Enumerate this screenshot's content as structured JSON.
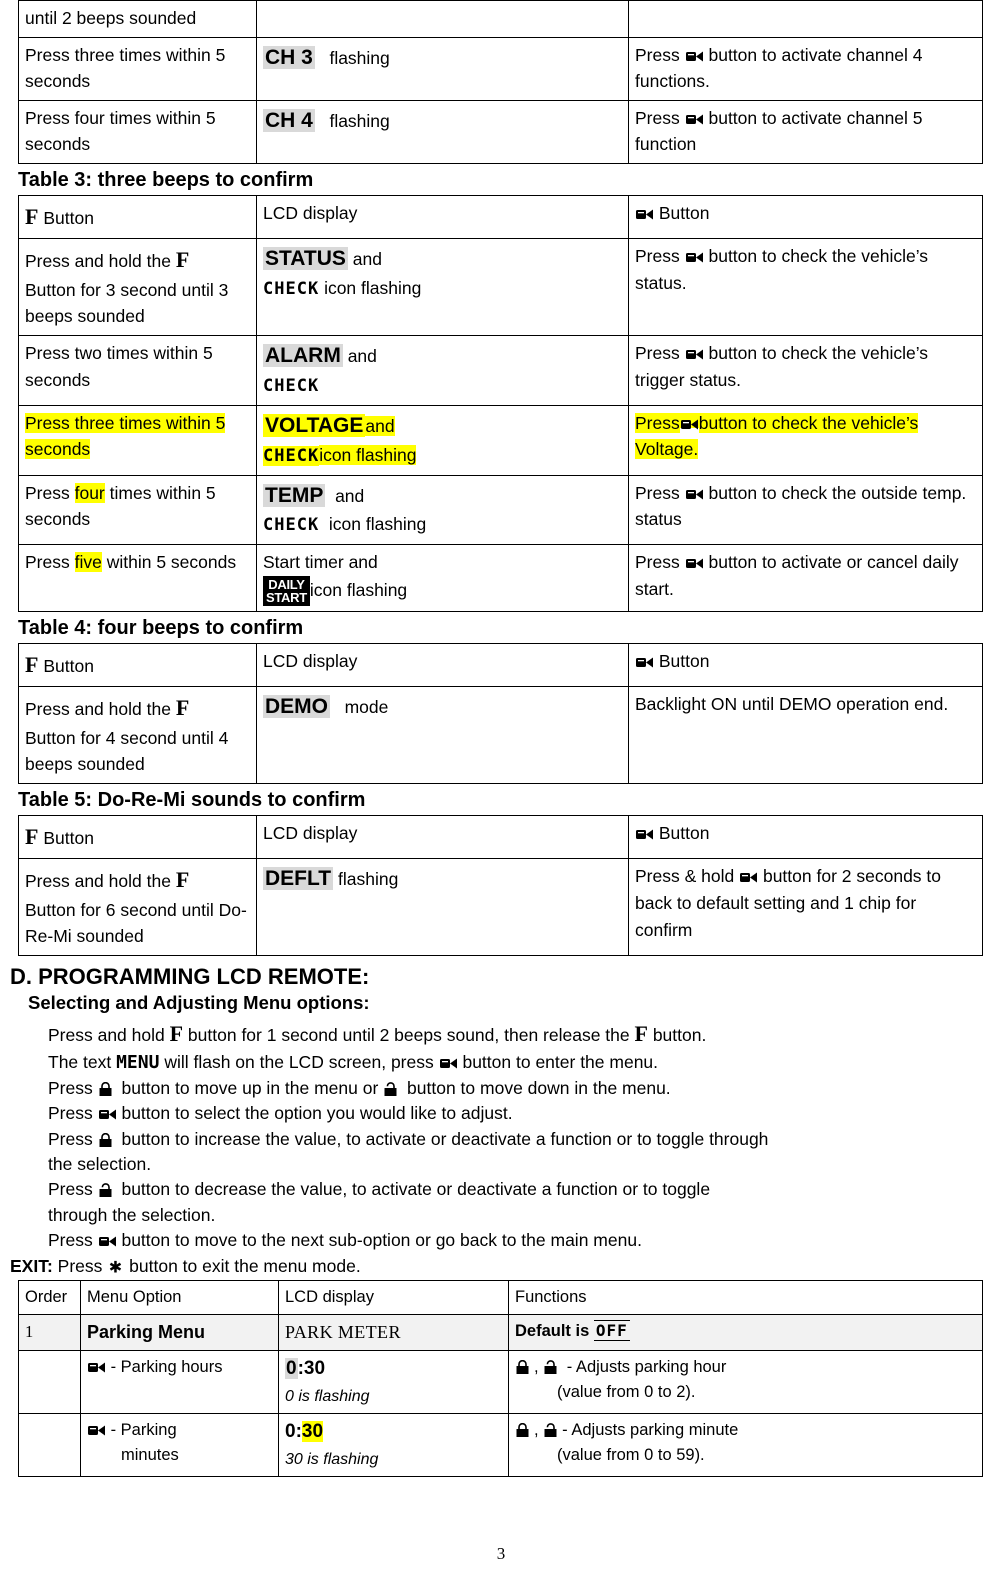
{
  "table2_tail": {
    "rows": [
      {
        "f": "until 2 beeps sounded",
        "lcd": "",
        "remote": ""
      },
      {
        "f": "Press three times within 5 seconds",
        "lcd_big": "CH 3",
        "lcd_rest": "flashing",
        "remote_pre": "Press",
        "remote_post": "button to activate channel 4 functions."
      },
      {
        "f": "Press four times within 5 seconds",
        "lcd_big": "CH 4",
        "lcd_rest": "flashing",
        "remote_pre": "Press",
        "remote_post": "button to activate channel 5 function"
      }
    ]
  },
  "table3": {
    "caption": "Table 3: three beeps to confirm",
    "headers": {
      "f": "Button",
      "lcd": "LCD display",
      "remote": "Button"
    },
    "rows": [
      {
        "f_pre": "Press and hold the",
        "f_post": "Button for 3 second until 3 beeps sounded",
        "lcd_big": "STATUS",
        "lcd_and": "and",
        "lcd_mono": "CHECK",
        "lcd_tail": "icon flashing",
        "remote_pre": "Press",
        "remote_post": "button to check the vehicle’s status.",
        "highlight": false
      },
      {
        "f_plain": "Press two times within 5 seconds",
        "lcd_big": "ALARM",
        "lcd_and": "and",
        "lcd_mono": "CHECK",
        "lcd_tail": "",
        "remote_pre": "Press",
        "remote_post": "button to check the vehicle’s trigger status.",
        "highlight": false
      },
      {
        "f_plain": "Press three times within 5 seconds",
        "lcd_big": "VOLTAGE",
        "lcd_and": "and",
        "lcd_mono": "CHECK",
        "lcd_tail": "icon flashing",
        "remote_pre": "Press",
        "remote_post": "button to check the vehicle’s Voltage.",
        "highlight": true
      },
      {
        "f_plain_a": "Press",
        "f_plain_hl": "four",
        "f_plain_b": "times within 5 seconds",
        "lcd_big": "TEMP",
        "lcd_and": "and",
        "lcd_mono": "CHECK",
        "lcd_tail": "icon flashing",
        "remote_pre": "Press",
        "remote_post": "button to check the outside temp. status",
        "highlight": false
      },
      {
        "f_plain_a": "Press",
        "f_plain_hl": "five",
        "f_plain_b": "within 5 seconds",
        "lcd_start": "Start timer and",
        "lcd_icon_line1": "DAILY",
        "lcd_icon_line2": "START",
        "lcd_tail": "icon flashing",
        "remote_pre": "Press",
        "remote_post": "button to activate or cancel daily start.",
        "highlight": false
      }
    ]
  },
  "table4": {
    "caption": "Table 4: four beeps to confirm",
    "headers": {
      "f": "Button",
      "lcd": "LCD display",
      "remote": "Button"
    },
    "rows": [
      {
        "f_pre": "Press and hold the",
        "f_post": "Button for 4 second until 4 beeps sounded",
        "lcd_big": "DEMO",
        "lcd_rest": "mode",
        "remote_plain": "Backlight ON until DEMO operation end."
      }
    ]
  },
  "table5": {
    "caption": "Table 5: Do-Re-Mi sounds to confirm",
    "headers": {
      "f": "Button",
      "lcd": "LCD display",
      "remote": "Button"
    },
    "rows": [
      {
        "f_pre": "Press and hold the",
        "f_post": "Button for 6 second until Do-Re-Mi sounded",
        "lcd_big": "DEFLT",
        "lcd_rest": "flashing",
        "remote_pre": "Press & hold",
        "remote_post": "button for 2 seconds to back to default setting and 1 chip for confirm"
      }
    ]
  },
  "section_d": {
    "title": "D. PROGRAMMING LCD REMOTE:",
    "subtitle": "Selecting and Adjusting Menu options:",
    "lines": [
      {
        "parts": [
          {
            "t": "Press and hold "
          },
          {
            "icon": "f-button"
          },
          {
            "t": " button for 1 second until 2 beeps sound, then release the "
          },
          {
            "icon": "f-button"
          },
          {
            "t": " button."
          }
        ]
      },
      {
        "parts": [
          {
            "t": "The text  "
          },
          {
            "icon": "menu-lcd"
          },
          {
            "t": "  will flash on the LCD screen, press "
          },
          {
            "icon": "remote-button"
          },
          {
            "t": " button to enter the menu."
          }
        ]
      },
      {
        "parts": [
          {
            "t": "Press "
          },
          {
            "icon": "lock-button"
          },
          {
            "t": " button to move up in the menu or "
          },
          {
            "icon": "unlock-button"
          },
          {
            "t": " button to move down in the menu."
          }
        ]
      },
      {
        "parts": [
          {
            "t": "Press "
          },
          {
            "icon": "remote-button"
          },
          {
            "t": " button to select the option you would like to adjust."
          }
        ]
      },
      {
        "parts": [
          {
            "t": "Press "
          },
          {
            "icon": "lock-button"
          },
          {
            "t": " button to increase the value, to activate or deactivate a function or to toggle through"
          }
        ]
      },
      {
        "parts": [
          {
            "t": "the selection."
          }
        ]
      },
      {
        "parts": [
          {
            "t": "Press "
          },
          {
            "icon": "unlock-button"
          },
          {
            "t": " button to decrease the value, to activate or deactivate a function or to toggle"
          }
        ]
      },
      {
        "parts": [
          {
            "t": "through the selection."
          }
        ]
      },
      {
        "parts": [
          {
            "t": "Press "
          },
          {
            "icon": "remote-button"
          },
          {
            "t": " button to move to the next sub-option or go back to the main menu."
          }
        ]
      }
    ],
    "exit_label": "EXIT:",
    "exit_pre": "Press",
    "exit_post": "button to exit the menu mode."
  },
  "menu_table": {
    "headers": {
      "order": "Order",
      "option": "Menu Option",
      "lcd": "LCD display",
      "functions": "Functions"
    },
    "rows": [
      {
        "order": "1",
        "option": "Parking Menu",
        "lcd": "PARK METER",
        "func_pre": "Default is",
        "func_off": "OFF",
        "shaded": true,
        "type": "main"
      },
      {
        "order": "",
        "option_icon": "remote-button",
        "option": "- Parking hours",
        "lcd_value": "0:30",
        "lcd_value_shade_first": "0",
        "lcd_note": "0 is flashing",
        "func_icons": [
          "lock-button",
          "unlock-button"
        ],
        "func_text": "- Adjusts parking hour",
        "func_text2": "(value from 0 to 2).",
        "shaded": false,
        "type": "sub"
      },
      {
        "order": "",
        "option_icon": "remote-button",
        "option": "- Parking",
        "option_line2": "minutes",
        "lcd_value": "0:30",
        "lcd_note": "30 is flashing",
        "func_icons": [
          "lock-button",
          "unlock-button"
        ],
        "func_text": "- Adjusts parking minute",
        "func_text2": "(value from 0 to 59).",
        "shaded": false,
        "type": "sub"
      }
    ]
  },
  "page_number": "3",
  "colors": {
    "highlight": "#ffff00",
    "lcd_shade": "#d9d9d9",
    "row_shade": "#f2f2f2"
  }
}
